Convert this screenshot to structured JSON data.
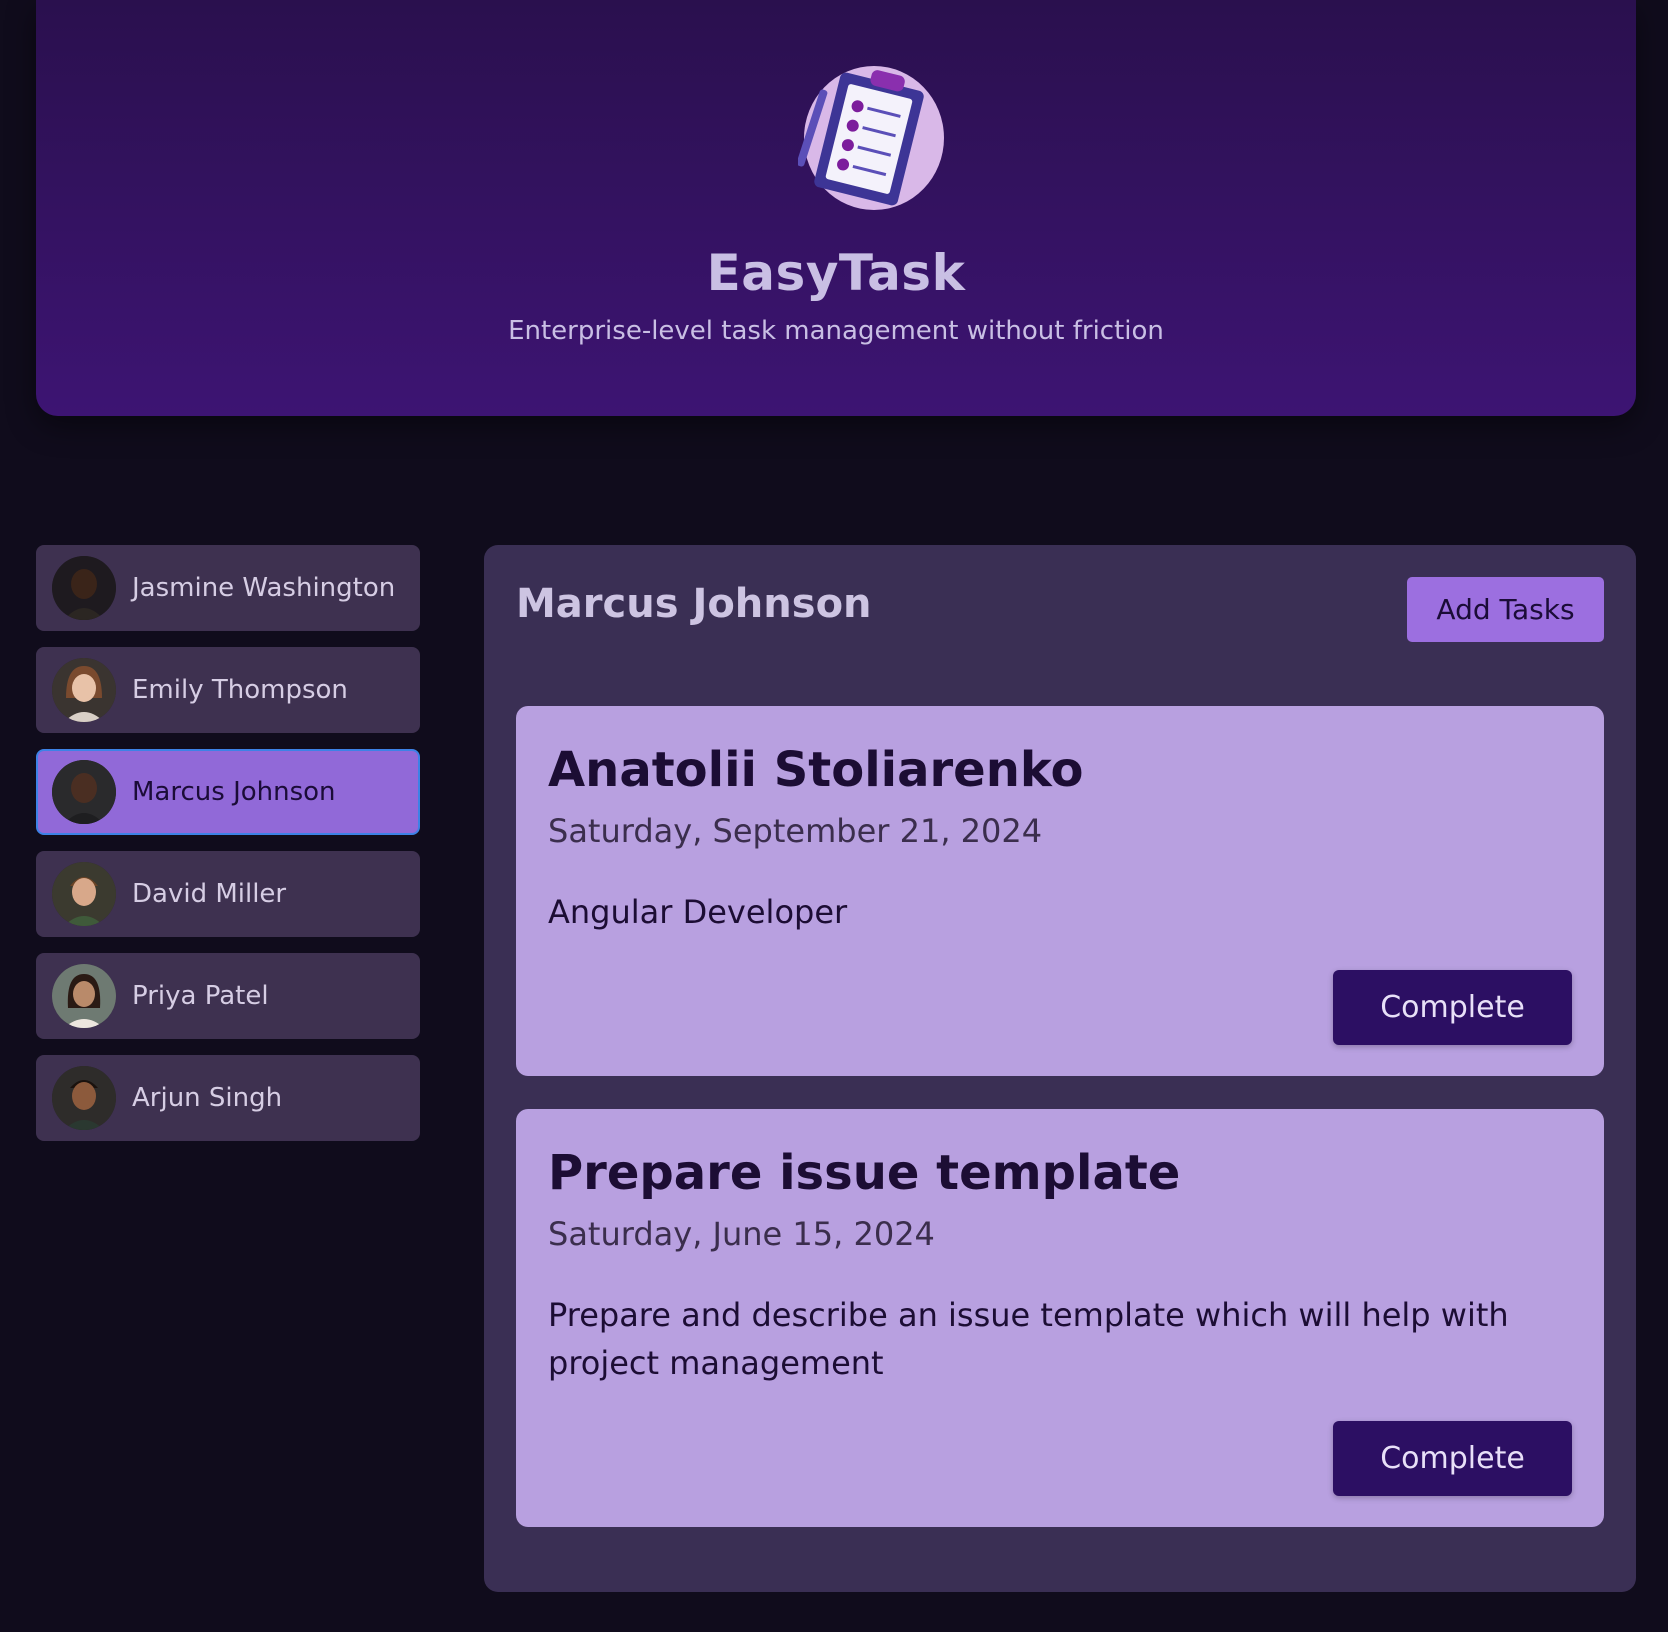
{
  "header": {
    "logo_icon": "clipboard-checklist-icon",
    "title": "EasyTask",
    "subtitle": "Enterprise-level task management without friction"
  },
  "users": [
    {
      "name": "Jasmine Washington",
      "avatar": "user-photo-avatar",
      "selected": false
    },
    {
      "name": "Emily Thompson",
      "avatar": "user-photo-avatar",
      "selected": false
    },
    {
      "name": "Marcus Johnson",
      "avatar": "user-photo-avatar",
      "selected": true
    },
    {
      "name": "David Miller",
      "avatar": "user-photo-avatar",
      "selected": false
    },
    {
      "name": "Priya Patel",
      "avatar": "user-photo-avatar",
      "selected": false
    },
    {
      "name": "Arjun Singh",
      "avatar": "user-photo-avatar",
      "selected": false
    }
  ],
  "tasks_panel": {
    "title": "Marcus Johnson",
    "add_button_label": "Add Tasks",
    "tasks": [
      {
        "title": "Anatolii Stoliarenko",
        "date": "Saturday, September 21, 2024",
        "summary": "Angular Developer",
        "complete_label": "Complete"
      },
      {
        "title": "Prepare issue template",
        "date": "Saturday, June 15, 2024",
        "summary": "Prepare and describe an issue template which will help with project management",
        "complete_label": "Complete"
      }
    ]
  },
  "colors": {
    "page_background": "#100c1c",
    "header_gradient_top": "#2a104e",
    "header_gradient_bottom": "#3d1473",
    "user_item": "#3e3150",
    "user_selected": "#9169d8",
    "selected_border": "#3d82e6",
    "panel": "#3a2f54",
    "task_card": "#b8a0e0",
    "add_button": "#9c6fe0",
    "complete_button": "#2c0f63"
  }
}
